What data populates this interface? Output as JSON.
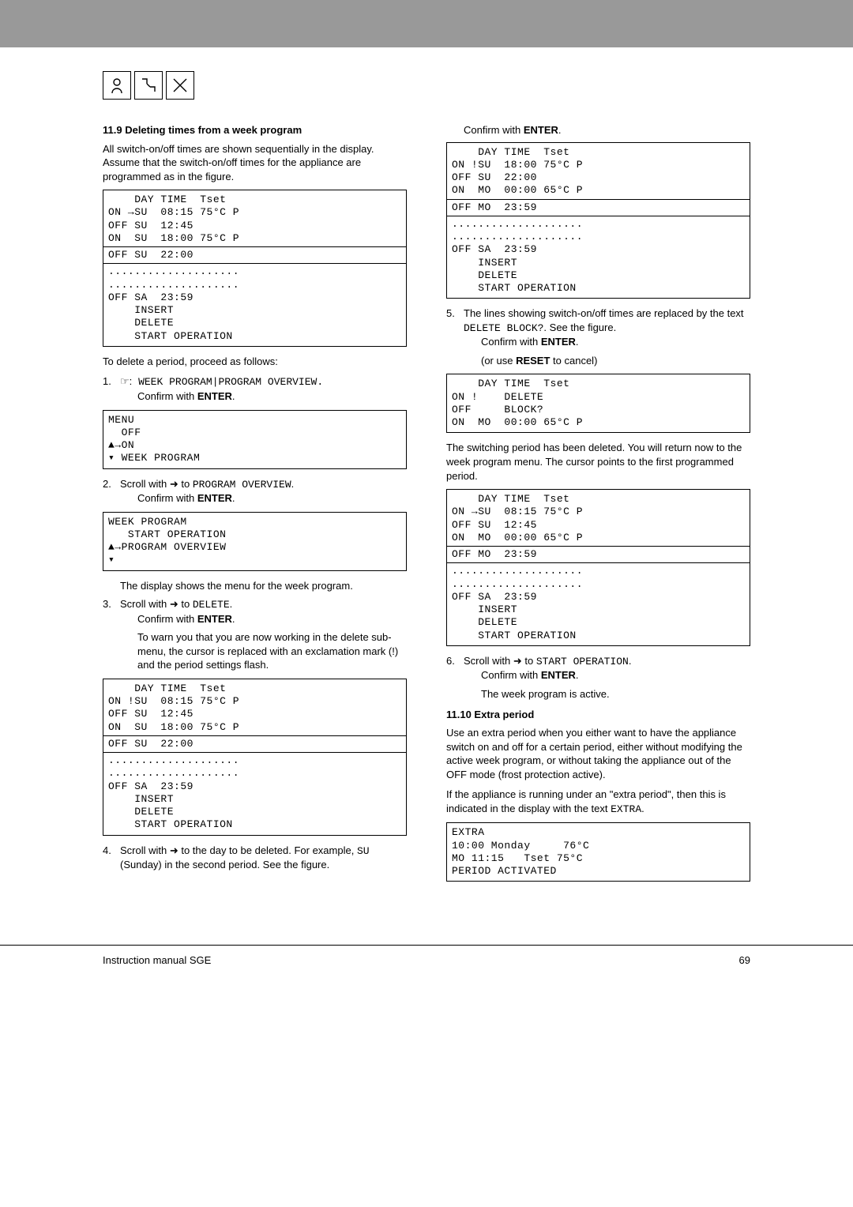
{
  "section1": {
    "heading": "11.9  Deleting times from a week program",
    "intro": "All switch-on/off times are shown sequentially in the display. Assume that the switch-on/off times for the appliance are programmed as in the figure.",
    "lcd1_l1": "    DAY TIME  Tset",
    "lcd1_l2": "ON →SU  08:15 75°C P",
    "lcd1_l3": "OFF SU  12:45",
    "lcd1_l4": "ON  SU  18:00 75°C P",
    "lcd1_l5": "OFF SU  22:00",
    "lcd1_l6": "....................",
    "lcd1_l7": "....................",
    "lcd1_l8": "OFF SA  23:59",
    "lcd1_l9": "    INSERT",
    "lcd1_l10": "    DELETE",
    "lcd1_l11": "    START OPERATION",
    "delete_intro": "To delete a period, proceed as follows:",
    "step1_a": "1.",
    "step1_b": " WEEK PROGRAM|PROGRAM OVERVIEW.",
    "confirm": "Confirm with ",
    "enter": "ENTER",
    "period": ".",
    "lcd2_l1": "MENU",
    "lcd2_l2": "  OFF",
    "lcd2_l3": "▲→ON",
    "lcd2_l4": "▾ WEEK PROGRAM",
    "step2_a": "2.",
    "step2_b": "Scroll with ➜ to ",
    "step2_c": "PROGRAM OVERVIEW",
    "lcd3_l1": "WEEK PROGRAM",
    "lcd3_l2": "   START OPERATION",
    "lcd3_l3": "▲→PROGRAM OVERVIEW",
    "lcd3_l4": "▾",
    "step2_desc": "The display shows the menu for the week program.",
    "step3_a": "3.",
    "step3_b": "Scroll with ➜ to ",
    "step3_c": "DELETE",
    "step3_desc": "To warn you that you are now working in the delete sub-menu, the cursor is replaced with an exclamation mark (!) and the period settings flash.",
    "lcd4_l1": "    DAY TIME  Tset",
    "lcd4_l2": "ON !SU  08:15 75°C P",
    "lcd4_l3": "OFF SU  12:45",
    "lcd4_l4": "ON  SU  18:00 75°C P",
    "lcd4_l5": "OFF SU  22:00",
    "lcd4_l6": "....................",
    "lcd4_l7": "....................",
    "lcd4_l8": "OFF SA  23:59",
    "lcd4_l9": "    INSERT",
    "lcd4_l10": "    DELETE",
    "lcd4_l11": "    START OPERATION",
    "step4_a": "4.",
    "step4_b": "Scroll with ➜ to the day to be deleted. For example, ",
    "step4_c": "SU",
    "step4_d": " (Sunday) in the second period. See the figure."
  },
  "col2": {
    "lcd5_l1": "    DAY TIME  Tset",
    "lcd5_l2": "ON !SU  18:00 75°C P",
    "lcd5_l3": "OFF SU  22:00",
    "lcd5_l4": "ON  MO  00:00 65°C P",
    "lcd5_l5": "OFF MO  23:59",
    "lcd5_l6": "....................",
    "lcd5_l7": "....................",
    "lcd5_l8": "OFF SA  23:59",
    "lcd5_l9": "    INSERT",
    "lcd5_l10": "    DELETE",
    "lcd5_l11": "    START OPERATION",
    "step5_a": "5.",
    "step5_b": "The lines showing switch-on/off times are replaced by the text ",
    "step5_c": "DELETE BLOCK?",
    "step5_d": ". See the figure.",
    "reset_a": "(or use ",
    "reset_b": "RESET",
    "reset_c": " to cancel)",
    "lcd6_l1": "    DAY TIME  Tset",
    "lcd6_l2": "ON !    DELETE",
    "lcd6_l3": "OFF     BLOCK?",
    "lcd6_l4": "ON  MO  00:00 65°C P",
    "afterdel": "The switching period has been deleted. You will return now to the week program menu. The cursor points to the first programmed period.",
    "lcd7_l1": "    DAY TIME  Tset",
    "lcd7_l2": "ON →SU  08:15 75°C P",
    "lcd7_l3": "OFF SU  12:45",
    "lcd7_l4": "ON  MO  00:00 65°C P",
    "lcd7_l5": "OFF MO  23:59",
    "lcd7_l6": "....................",
    "lcd7_l7": "....................",
    "lcd7_l8": "OFF SA  23:59",
    "lcd7_l9": "    INSERT",
    "lcd7_l10": "    DELETE",
    "lcd7_l11": "    START OPERATION",
    "step6_a": "6.",
    "step6_b": "Scroll with ➜ to ",
    "step6_c": "START OPERATION",
    "step6_desc": "The week program is active.",
    "heading2": "11.10 Extra period",
    "extra_p1": "Use an extra period when you either want to have the appliance switch on and off for a certain period, either without modifying the active week program, or without taking the appliance out of the OFF mode (frost protection active).",
    "extra_p2a": "If the appliance is running under an \"extra period\", then this is indicated in the display with the text ",
    "extra_p2b": "EXTRA",
    "lcd8_l1": "EXTRA",
    "lcd8_l2": "10:00 Monday     76°C",
    "lcd8_l3": "MO 11:15   Tset 75°C",
    "lcd8_l4": "PERIOD ACTIVATED"
  },
  "footer": {
    "left": "Instruction manual SGE",
    "right": "69"
  }
}
